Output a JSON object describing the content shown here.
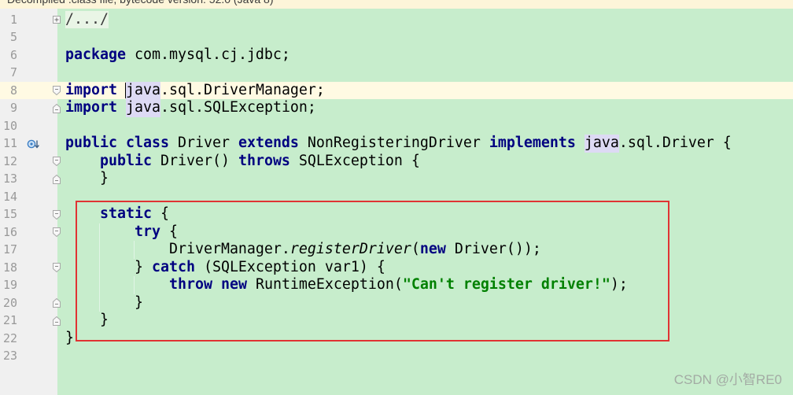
{
  "banner": {
    "text": "Decompiled .class file, bytecode version: 52.0 (Java 8)"
  },
  "colors": {
    "banner_bg": "#fdf5d9",
    "gutter_bg": "#f0f0f0",
    "editor_bg": "#c7edcc",
    "current_line_bg": "#fffae3",
    "line_number": "#999999",
    "text": "#000000",
    "keyword": "#000080",
    "string": "#008000",
    "usage_highlight": "#dddaf4",
    "fold_bg": "#e9f5e6",
    "indent_guide": "#e2f5e6",
    "annotation": "#e03333",
    "watermark": "#a3aba4"
  },
  "editor": {
    "lines": [
      {
        "num": "1",
        "fold_icon": "fold-collapsed-icon",
        "tokens": [
          {
            "style": "folded",
            "t": "/.../"
          }
        ]
      },
      {
        "num": "5",
        "tokens": []
      },
      {
        "num": "6",
        "tokens": [
          {
            "style": "keyword",
            "t": "package"
          },
          {
            "style": "plain",
            "t": " com.mysql.cj.jdbc;"
          }
        ]
      },
      {
        "num": "7",
        "tokens": []
      },
      {
        "num": "8",
        "current": true,
        "fold_icon": "fold-start-icon",
        "tokens": [
          {
            "style": "keyword",
            "t": "import"
          },
          {
            "style": "plain",
            "t": " "
          },
          {
            "style": "caret"
          },
          {
            "style": "usage-highlight",
            "t": "java"
          },
          {
            "style": "plain",
            "t": ".sql.DriverManager;"
          }
        ]
      },
      {
        "num": "9",
        "fold_icon": "fold-end-icon",
        "tokens": [
          {
            "style": "keyword",
            "t": "import"
          },
          {
            "style": "plain",
            "t": " "
          },
          {
            "style": "usage-highlight",
            "t": "java"
          },
          {
            "style": "plain",
            "t": ".sql.SQLException;"
          }
        ]
      },
      {
        "num": "10",
        "tokens": []
      },
      {
        "num": "11",
        "gutter_icon": "implements-icon",
        "tokens": [
          {
            "style": "keyword",
            "t": "public"
          },
          {
            "style": "plain",
            "t": " "
          },
          {
            "style": "keyword",
            "t": "class"
          },
          {
            "style": "plain",
            "t": " Driver "
          },
          {
            "style": "keyword",
            "t": "extends"
          },
          {
            "style": "plain",
            "t": " NonRegisteringDriver "
          },
          {
            "style": "keyword",
            "t": "implements"
          },
          {
            "style": "plain",
            "t": " "
          },
          {
            "style": "usage-highlight",
            "t": "java"
          },
          {
            "style": "plain",
            "t": ".sql.Driver {"
          }
        ]
      },
      {
        "num": "12",
        "fold_icon": "fold-start-icon",
        "tokens": [
          {
            "style": "plain",
            "t": "    "
          },
          {
            "style": "keyword",
            "t": "public"
          },
          {
            "style": "plain",
            "t": " Driver() "
          },
          {
            "style": "keyword",
            "t": "throws"
          },
          {
            "style": "plain",
            "t": " SQLException {"
          }
        ]
      },
      {
        "num": "13",
        "fold_icon": "fold-end-icon",
        "tokens": [
          {
            "style": "plain",
            "t": "    }"
          }
        ]
      },
      {
        "num": "14",
        "tokens": []
      },
      {
        "num": "15",
        "fold_icon": "fold-start-icon",
        "tokens": [
          {
            "style": "plain",
            "t": "    "
          },
          {
            "style": "keyword",
            "t": "static"
          },
          {
            "style": "plain",
            "t": " {"
          }
        ]
      },
      {
        "num": "16",
        "fold_icon": "fold-start-icon",
        "tokens": [
          {
            "style": "plain",
            "t": "        "
          },
          {
            "style": "keyword",
            "t": "try"
          },
          {
            "style": "plain",
            "t": " {"
          }
        ]
      },
      {
        "num": "17",
        "tokens": [
          {
            "style": "plain",
            "t": "            DriverManager."
          },
          {
            "style": "static-call",
            "t": "registerDriver"
          },
          {
            "style": "plain",
            "t": "("
          },
          {
            "style": "keyword",
            "t": "new"
          },
          {
            "style": "plain",
            "t": " Driver());"
          }
        ]
      },
      {
        "num": "18",
        "fold_icon": "fold-start-icon",
        "tokens": [
          {
            "style": "plain",
            "t": "        } "
          },
          {
            "style": "keyword",
            "t": "catch"
          },
          {
            "style": "plain",
            "t": " (SQLException var1) {"
          }
        ]
      },
      {
        "num": "19",
        "tokens": [
          {
            "style": "plain",
            "t": "            "
          },
          {
            "style": "keyword",
            "t": "throw"
          },
          {
            "style": "plain",
            "t": " "
          },
          {
            "style": "keyword",
            "t": "new"
          },
          {
            "style": "plain",
            "t": " RuntimeException("
          },
          {
            "style": "string",
            "t": "\"Can't register driver!\""
          },
          {
            "style": "plain",
            "t": ");"
          }
        ]
      },
      {
        "num": "20",
        "fold_icon": "fold-end-icon",
        "tokens": [
          {
            "style": "plain",
            "t": "        }"
          }
        ]
      },
      {
        "num": "21",
        "fold_icon": "fold-end-icon",
        "tokens": [
          {
            "style": "plain",
            "t": "    }"
          }
        ]
      },
      {
        "num": "22",
        "tokens": [
          {
            "style": "plain",
            "t": "}"
          }
        ]
      },
      {
        "num": "23",
        "tokens": []
      }
    ]
  },
  "watermark": "CSDN @小智RE0"
}
